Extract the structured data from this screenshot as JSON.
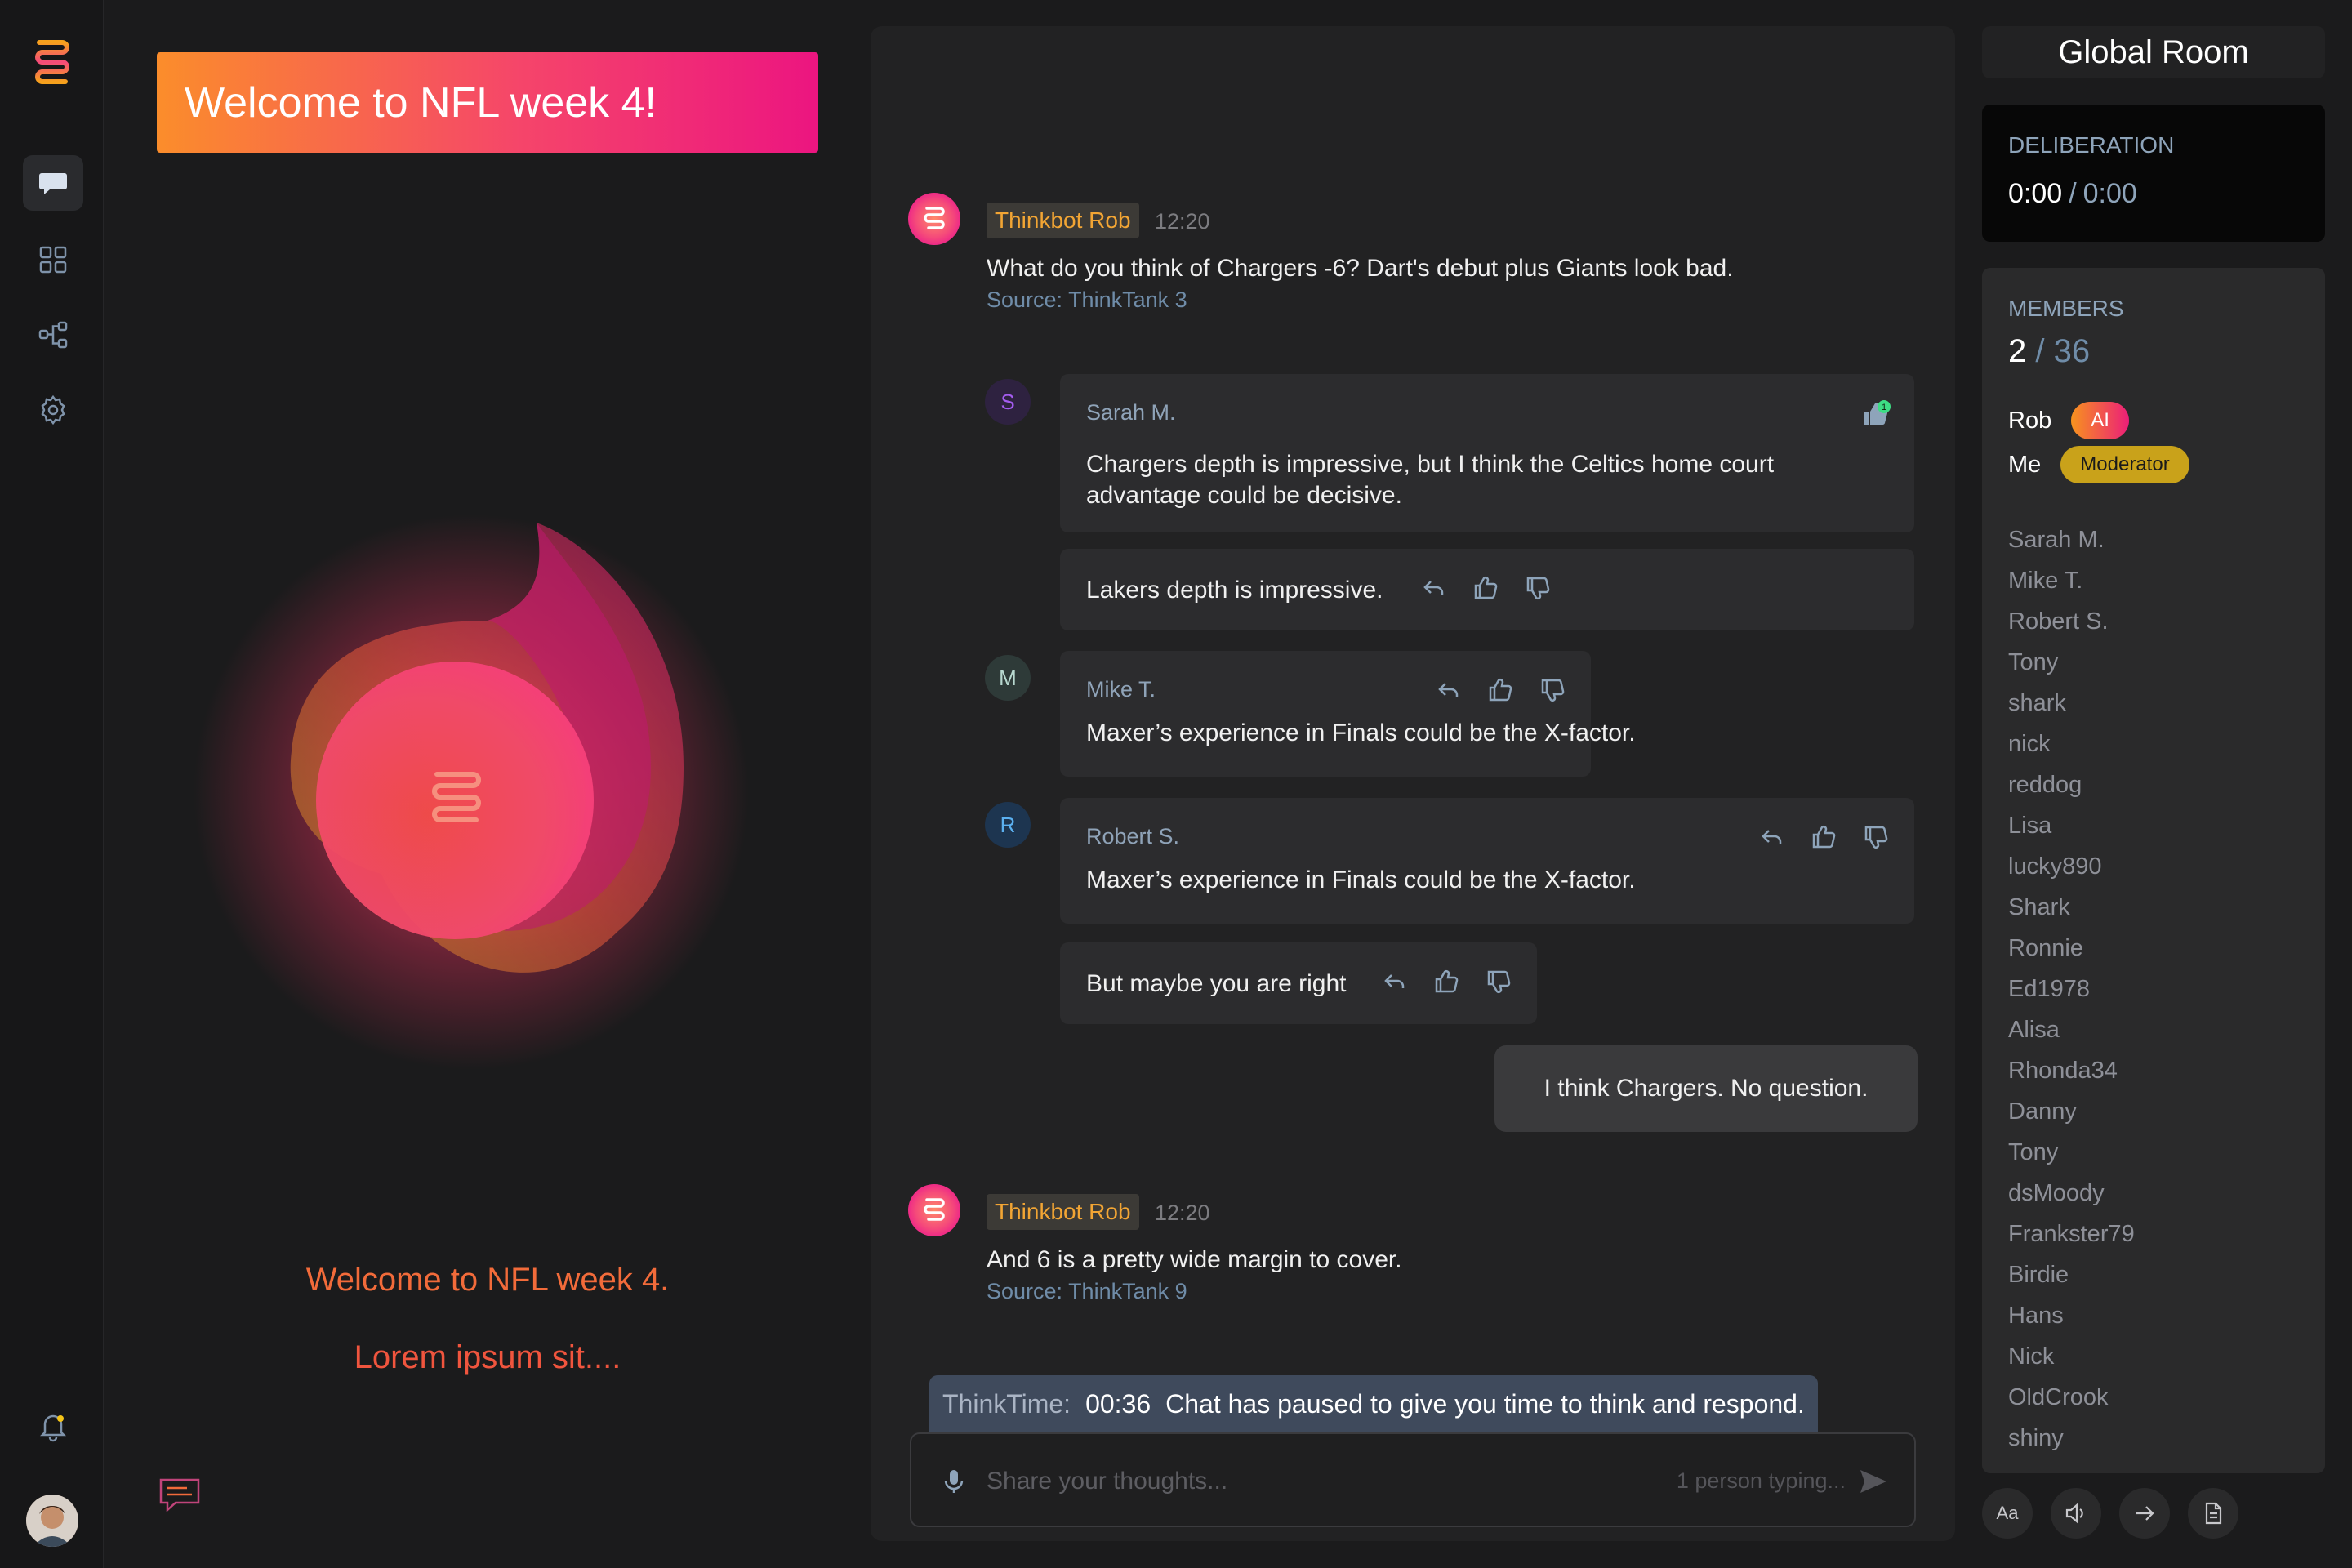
{
  "hero": {
    "banner_title": "Welcome to NFL week 4!",
    "welcome_line": "Welcome to NFL week 4.",
    "lorem_line": "Lorem ipsum sit...."
  },
  "chat": {
    "bot1": {
      "name": "Thinkbot Rob",
      "time": "12:20",
      "text": "What do you think of Chargers -6? Dart's debut plus Giants look bad.",
      "source": "Source: ThinkTank 3"
    },
    "sarah": {
      "initial": "S",
      "name": "Sarah M.",
      "text": "Chargers depth is impressive, but I think the Celtics home court advantage could be decisive.",
      "like_count": "1"
    },
    "reply1": {
      "text": "Lakers depth is impressive."
    },
    "mike": {
      "initial": "M",
      "name": "Mike T.",
      "text": "Maxer’s experience in Finals could be the X-factor."
    },
    "robert": {
      "initial": "R",
      "name": "Robert S.",
      "text": "Maxer’s experience in Finals could be the X-factor."
    },
    "reply2": {
      "text": "But maybe you are right"
    },
    "mine": {
      "text": "I think Chargers. No question."
    },
    "bot2": {
      "name": "Thinkbot Rob",
      "time": "12:20",
      "text": "And 6 is a pretty wide margin to cover.",
      "source": "Source: ThinkTank 9"
    },
    "thinktime": {
      "label": "ThinkTime:",
      "clock": "00:36",
      "message": "Chat has paused to give you time to think and respond."
    },
    "composer": {
      "placeholder": "Share your thoughts...",
      "typing": "1 person typing..."
    }
  },
  "sidebar": {
    "room_title": "Global Room",
    "deliberation": {
      "label": "DELIBERATION",
      "elapsed": "0:00",
      "separator": "/",
      "total": "0:00"
    },
    "members": {
      "label": "MEMBERS",
      "online": "2",
      "total": "/ 36",
      "rob": {
        "name": "Rob",
        "badge": "AI"
      },
      "me": {
        "name": "Me",
        "badge": "Moderator"
      },
      "list": [
        "Sarah M.",
        "Mike T.",
        "Robert S.",
        "Tony",
        "shark",
        "nick",
        "reddog",
        "Lisa",
        "lucky890",
        "Shark",
        "Ronnie",
        "Ed1978",
        "Alisa",
        "Rhonda34",
        "Danny",
        "Tony",
        "dsMoody",
        "Frankster79",
        "Birdie",
        "Hans",
        "Nick",
        "OldCrook",
        "shiny"
      ]
    },
    "tools": {
      "font_size_label": "Aa"
    }
  },
  "colors": {
    "accent_orange": "#f7931e",
    "accent_pink": "#ec1e79",
    "moderator": "#c9a21a",
    "link_blue": "#6f8ca8"
  }
}
